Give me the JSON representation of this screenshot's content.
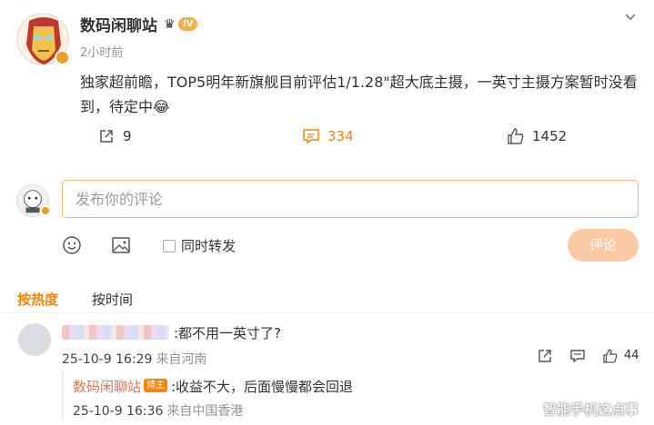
{
  "post": {
    "author": "数码闲聊站",
    "level": "IV",
    "time": "2小时前",
    "text": "独家超前瞻，TOP5明年新旗舰目前评估1/1.28\"超大底主摄，一英寸主摄方案暂时没看到，待定中😂",
    "reposts": "9",
    "comments": "334",
    "likes": "1452"
  },
  "composer": {
    "placeholder": "发布你的评论",
    "repost_label": "同时转发",
    "submit_label": "评论"
  },
  "sort_tabs": {
    "hot": "按热度",
    "time": "按时间"
  },
  "comment": {
    "text": ":都不用一英寸了?",
    "time": "25-10-9 16:29",
    "source": "来自河南",
    "likes": "44"
  },
  "reply": {
    "author": "数码闲聊站",
    "badge": "博主",
    "text": ":收益不大，后面慢慢都会回退",
    "time": "25-10-9 16:36",
    "source": "来自中国香港"
  },
  "watermark": "智能手机这点事",
  "colors": {
    "accent": "#ff8200",
    "link": "#eb7350",
    "muted": "#939393",
    "input_border": "#f7b57e",
    "submit_disabled": "#fcc9a3"
  },
  "icons": [
    "chevron-down-icon",
    "repost-icon",
    "comment-icon",
    "like-icon",
    "emoji-icon",
    "image-icon",
    "share-icon"
  ]
}
